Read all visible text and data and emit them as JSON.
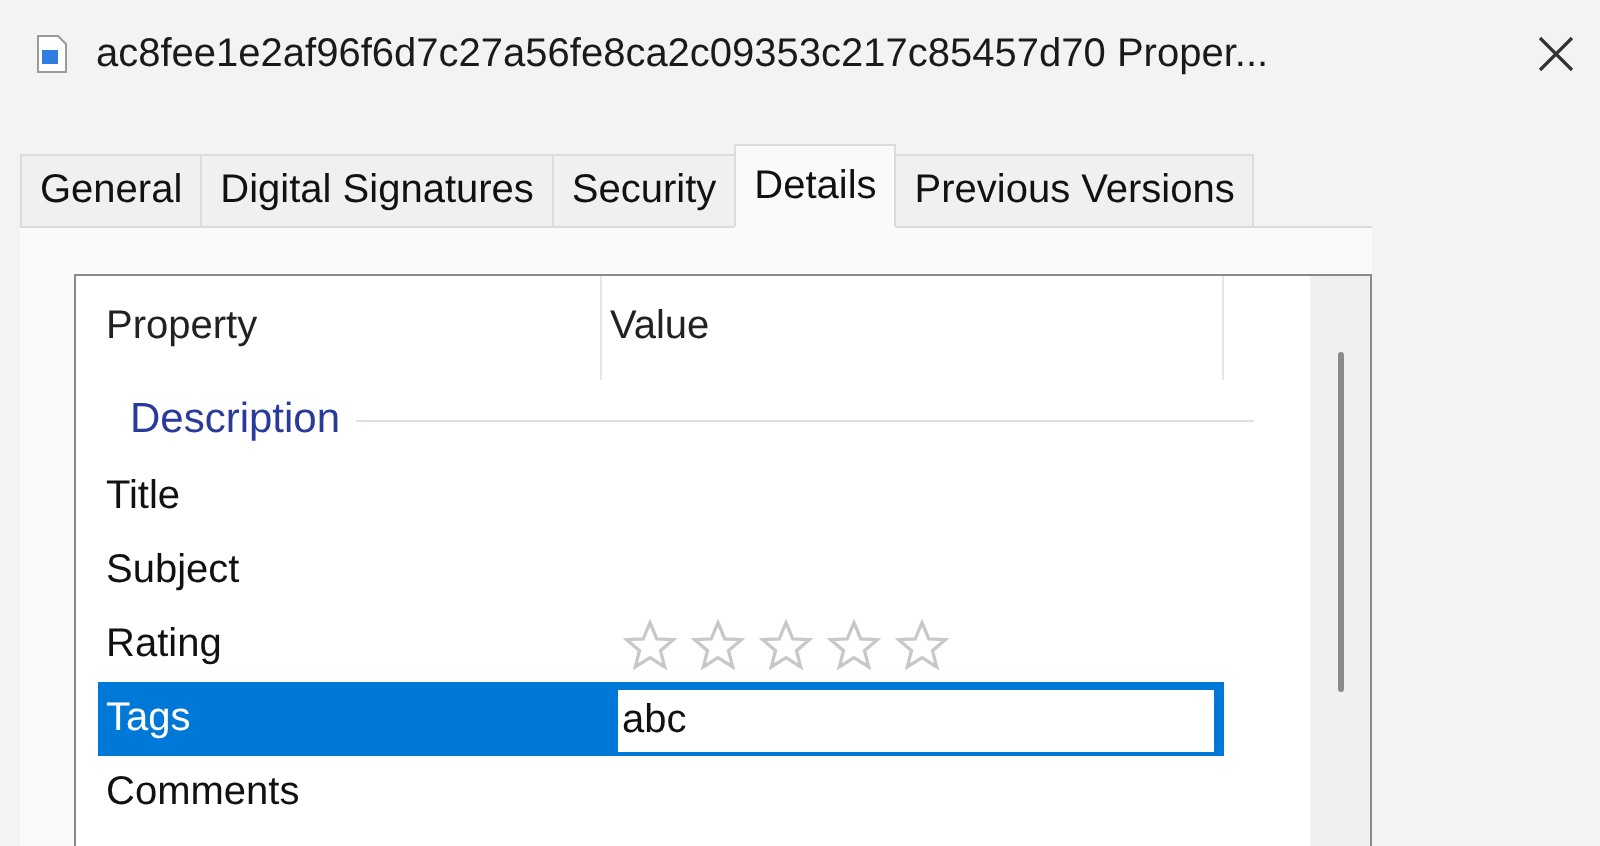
{
  "window": {
    "title": "ac8fee1e2af96f6d7c27a56fe8ca2c09353c217c85457d70 Proper..."
  },
  "tabs": [
    {
      "label": "General",
      "selected": false
    },
    {
      "label": "Digital Signatures",
      "selected": false
    },
    {
      "label": "Security",
      "selected": false
    },
    {
      "label": "Details",
      "selected": true
    },
    {
      "label": "Previous Versions",
      "selected": false
    }
  ],
  "table": {
    "columns": [
      "Property",
      "Value"
    ],
    "group": "Description",
    "rows": [
      {
        "name": "Title",
        "kind": "text",
        "selected": false
      },
      {
        "name": "Subject",
        "kind": "text",
        "selected": false
      },
      {
        "name": "Rating",
        "kind": "rating",
        "stars": 0,
        "selected": false
      },
      {
        "name": "Tags",
        "kind": "text",
        "value": "abc",
        "selected": true
      },
      {
        "name": "Comments",
        "kind": "text",
        "selected": false
      }
    ]
  }
}
